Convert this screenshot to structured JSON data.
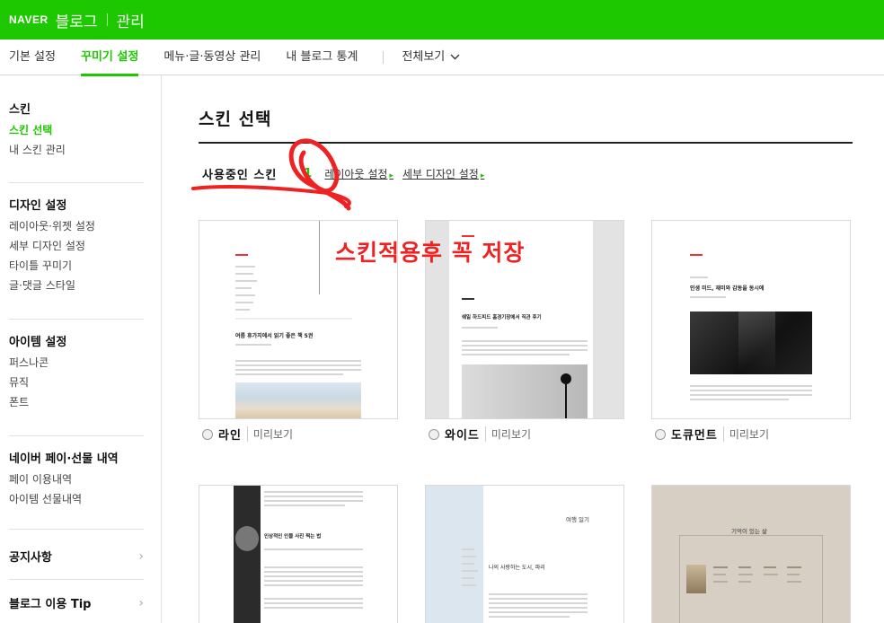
{
  "header": {
    "logo": "NAVER",
    "blog": "블로그",
    "manage": "관리"
  },
  "tabs": [
    {
      "label": "기본 설정"
    },
    {
      "label": "꾸미기 설정",
      "active": true
    },
    {
      "label": "메뉴·글·동영상 관리"
    },
    {
      "label": "내 블로그 통계"
    }
  ],
  "tab_all": {
    "label": "전체보기"
  },
  "sidebar": {
    "groups": [
      {
        "head": "스킨",
        "items": [
          "스킨 선택",
          "내 스킨 관리"
        ],
        "active": "스킨 선택"
      },
      {
        "head": "디자인 설정",
        "items": [
          "레이아웃·위젯 설정",
          "세부 디자인 설정",
          "타이틀 꾸미기",
          "글·댓글 스타일"
        ]
      },
      {
        "head": "아이템 설정",
        "items": [
          "퍼스나콘",
          "뮤직",
          "폰트"
        ]
      },
      {
        "head": "네이버 페이·선물 내역",
        "items": [
          "페이 이용내역",
          "아이템 선물내역"
        ]
      }
    ],
    "links": [
      "공지사항",
      "블로그 이용 Tip"
    ]
  },
  "main": {
    "title": "스킨 선택",
    "using_label": "사용중인 스킨",
    "using_count": "1",
    "layout_link": "레이아웃 설정",
    "detail_link": "세부 디자인 설정"
  },
  "skins": [
    {
      "name": "라인",
      "preview": "미리보기",
      "article": "여름 휴가지에서 읽기 좋은 책 5권"
    },
    {
      "name": "와이드",
      "preview": "미리보기",
      "article": "쉐일 하드피드 홈경기장에서 직관 후기"
    },
    {
      "name": "도큐먼트",
      "preview": "미리보기",
      "article": "인생 미드, 재미와 감동을 동시에"
    },
    {
      "article": "인상적인 인물 사진 찍는 법"
    },
    {
      "title": "여행 일기",
      "article": "나의 사랑하는 도시, 파리"
    },
    {
      "title": "기억이 있는 삶"
    }
  ],
  "annotation": {
    "text": "스킨적용후 꼭 저장",
    "color": "#ee2222"
  },
  "colors": {
    "brand": "#1ec800"
  }
}
